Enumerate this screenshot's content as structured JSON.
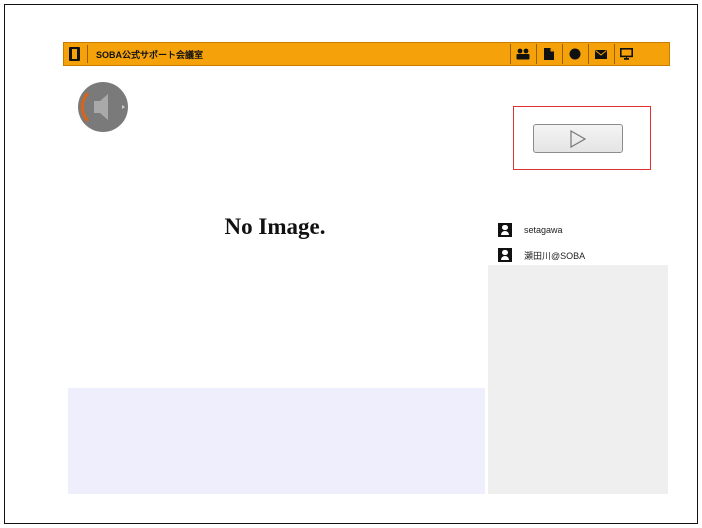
{
  "toolbar": {
    "room_title": "SOBA公式サポート会議室",
    "icons": [
      "room-door-icon",
      "participants-icon",
      "document-icon",
      "record-icon",
      "mail-icon",
      "display-icon"
    ]
  },
  "speaker": {
    "icon": "speaker-icon"
  },
  "player": {
    "icon": "play-icon"
  },
  "video": {
    "no_image_text": "No Image."
  },
  "participants": [
    {
      "name": "setagawa",
      "icon": "user-icon"
    },
    {
      "name": "瀬田川@SOBA",
      "icon": "user-icon"
    }
  ],
  "colors": {
    "toolbar": "#f5a20a",
    "highlight_outline": "#e03030",
    "side_panel": "#efefef",
    "bottom_panel": "#eeeefc"
  }
}
